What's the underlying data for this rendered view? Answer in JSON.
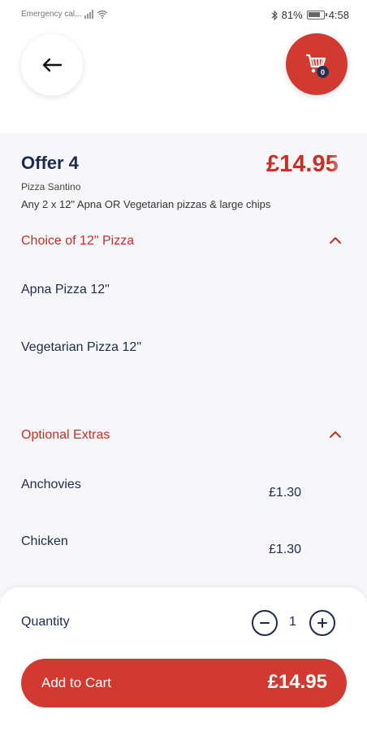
{
  "status_bar": {
    "carrier_text": "Emergency cal...",
    "battery_percent": "81%",
    "time": "4:58",
    "icons": [
      "signal-icon",
      "wifi-icon",
      "bluetooth-icon",
      "battery-icon"
    ]
  },
  "header": {
    "back_icon": "arrow-left-icon",
    "cart_icon": "shopping-cart-icon",
    "cart_count": "0"
  },
  "product": {
    "title": "Offer 4",
    "price": "£14.95",
    "restaurant": "Pizza Santino",
    "description": "Any 2 x 12\" Apna OR Vegetarian pizzas & large chips"
  },
  "sections": {
    "pizza_choice": {
      "title": "Choice of 12\" Pizza",
      "expanded": true,
      "options": [
        "Apna Pizza 12\"",
        "Vegetarian Pizza 12\""
      ]
    },
    "extras": {
      "title": "Optional Extras",
      "expanded": true,
      "items": [
        {
          "name": "Anchovies",
          "price": "£1.30"
        },
        {
          "name": "Chicken",
          "price": "£1.30"
        }
      ]
    }
  },
  "footer": {
    "quantity_label": "Quantity",
    "quantity": "1",
    "add_to_cart_label": "Add to Cart",
    "total_price": "£14.95"
  },
  "colors": {
    "accent": "#d13a30",
    "price_red": "#c62f25",
    "navy": "#1d2b4f",
    "content_bg": "#f7f7f9"
  }
}
